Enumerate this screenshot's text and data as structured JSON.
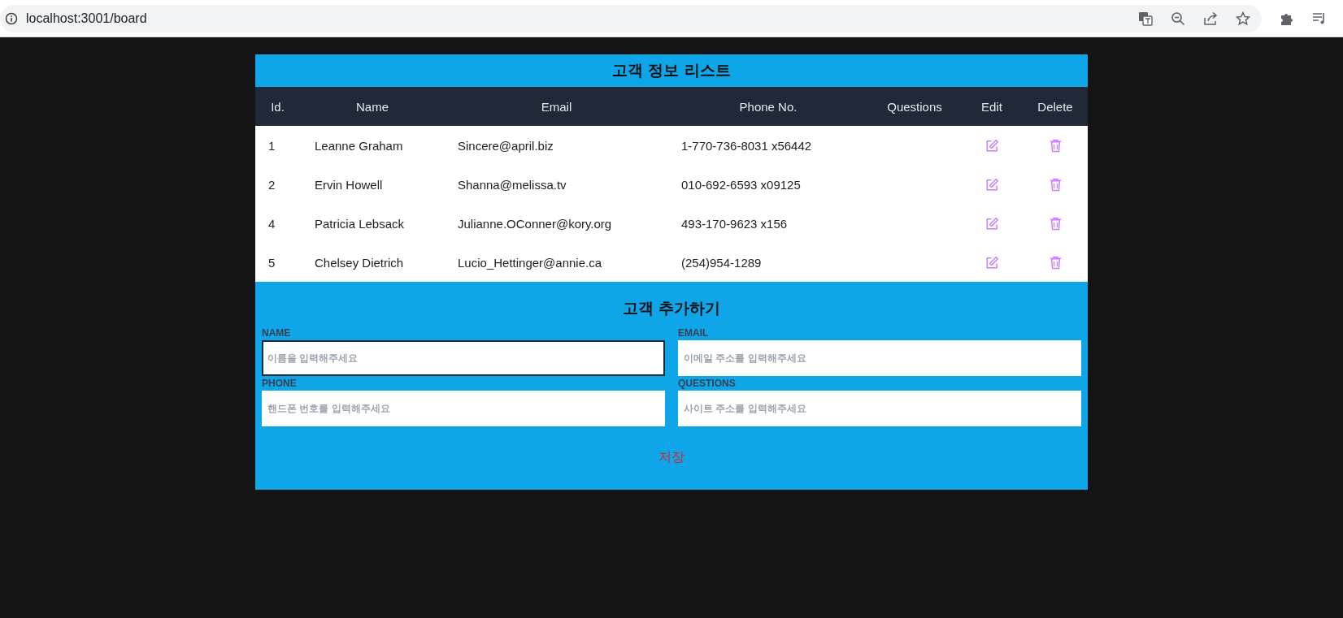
{
  "browser": {
    "url": "localhost:3001/board"
  },
  "table": {
    "title": "고객 정보 리스트",
    "columns": [
      "Id.",
      "Name",
      "Email",
      "Phone No.",
      "Questions",
      "Edit",
      "Delete"
    ],
    "rows": [
      {
        "id": "1",
        "name": "Leanne Graham",
        "email": "Sincere@april.biz",
        "phone": "1-770-736-8031 x56442"
      },
      {
        "id": "2",
        "name": "Ervin Howell",
        "email": "Shanna@melissa.tv",
        "phone": "010-692-6593 x09125"
      },
      {
        "id": "4",
        "name": "Patricia Lebsack",
        "email": "Julianne.OConner@kory.org",
        "phone": "493-170-9623 x156"
      },
      {
        "id": "5",
        "name": "Chelsey Dietrich",
        "email": "Lucio_Hettinger@annie.ca",
        "phone": "(254)954-1289"
      }
    ]
  },
  "form": {
    "title": "고객 추가하기",
    "fields": [
      {
        "label": "NAME",
        "placeholder": "이름을 입력해주세요",
        "focused": true
      },
      {
        "label": "EMAIL",
        "placeholder": "이메일 주소를 입력해주세요",
        "focused": false
      },
      {
        "label": "PHONE",
        "placeholder": "핸드폰 번호를 입력해주세요",
        "focused": false
      },
      {
        "label": "QUESTIONS",
        "placeholder": "사이트 주소를 입력해주세요",
        "focused": false
      }
    ],
    "submit": "저장"
  }
}
